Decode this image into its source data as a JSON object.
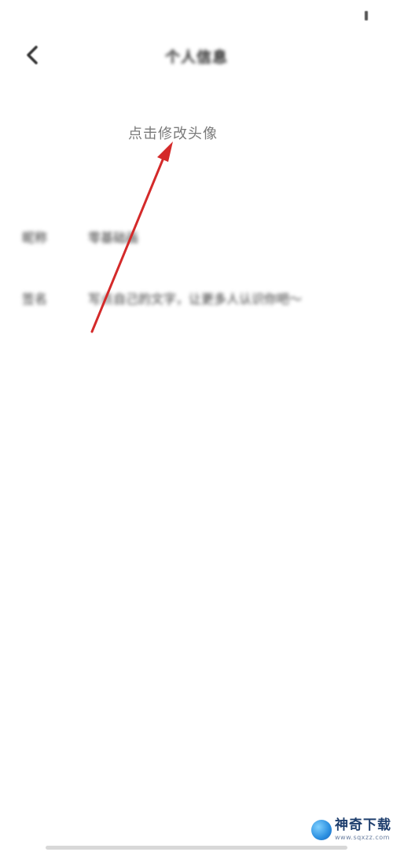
{
  "header": {
    "title": "个人信息",
    "back_icon": "chevron-left-icon"
  },
  "avatar": {
    "hint": "点击修改头像"
  },
  "profile": {
    "nickname_label": "昵称",
    "nickname_value": "零基础画",
    "signature_label": "签名",
    "signature_value": "写点自己的文字，让更多人认识你吧～"
  },
  "annotation": {
    "arrow_color": "#d42a2a"
  },
  "watermark": {
    "name": "神奇下载",
    "url": "www.sqxzz.com"
  }
}
